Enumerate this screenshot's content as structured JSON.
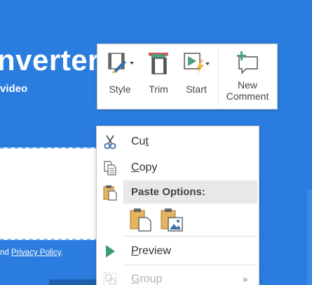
{
  "slide": {
    "title": "nverter",
    "subtitle": "video",
    "policy_prefix": "nd ",
    "policy_link": "Privacy Policy",
    "policy_suffix": "."
  },
  "mini_toolbar": {
    "style_label": "Style",
    "trim_label": "Trim",
    "start_label": "Start",
    "new_comment_line1": "New",
    "new_comment_line2": "Comment"
  },
  "context_menu": {
    "cut": {
      "pre": "Cu",
      "accel": "t",
      "post": ""
    },
    "copy": {
      "pre": "",
      "accel": "C",
      "post": "opy"
    },
    "paste_options_label": "Paste Options:",
    "preview": {
      "pre": "",
      "accel": "P",
      "post": "review"
    },
    "group": {
      "pre": "",
      "accel": "G",
      "post": "roup"
    }
  },
  "colors": {
    "background": "#2b7cdf",
    "preview_green": "#3f9a77",
    "trim_red": "#d9534f",
    "start_green": "#4b9e7e",
    "accent_yellow": "#f2b642"
  },
  "icons": {
    "style": "style-brush-icon",
    "trim": "trim-film-icon",
    "start": "start-lightning-icon",
    "new_comment": "new-comment-icon",
    "cut": "scissors-icon",
    "copy": "copy-icon",
    "paste": "clipboard-icon",
    "paste_keep": "paste-keep-source-icon",
    "paste_picture": "paste-picture-icon",
    "preview": "play-triangle-icon",
    "group": "group-icon"
  }
}
